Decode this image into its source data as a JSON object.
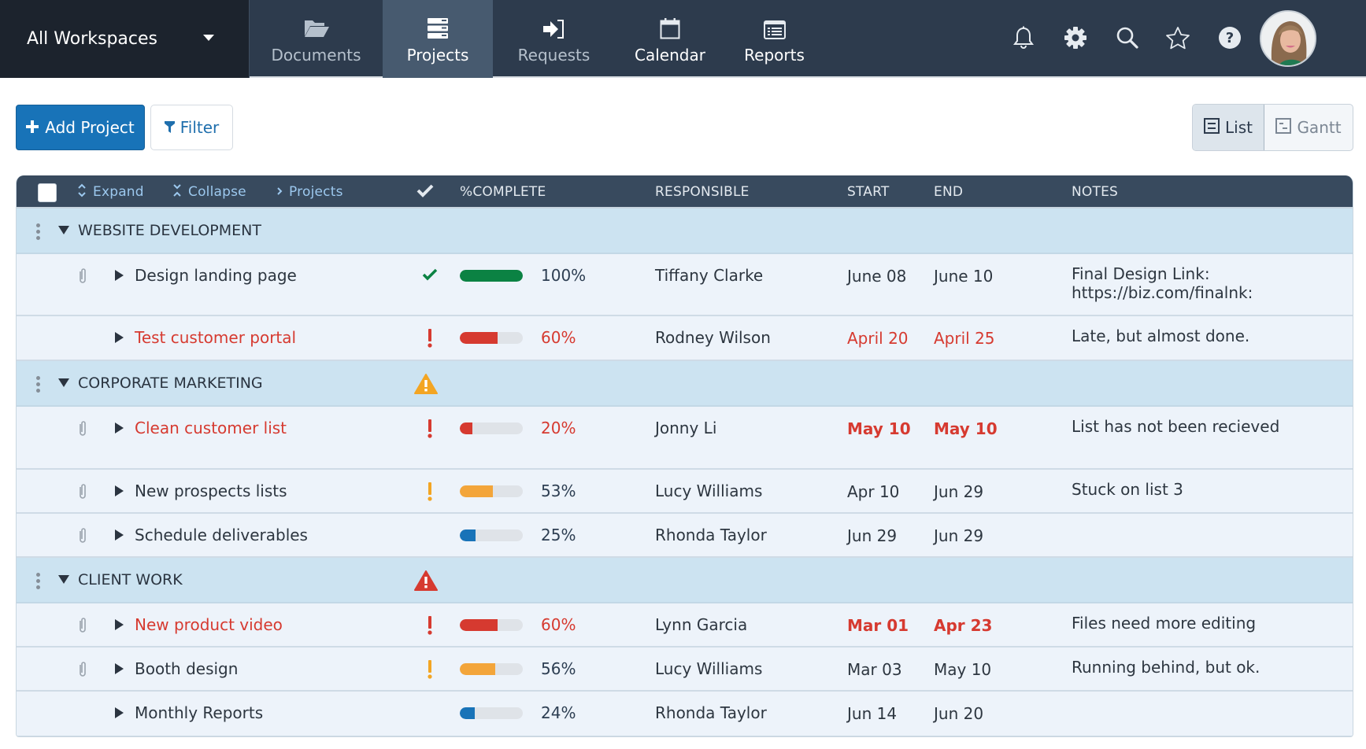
{
  "topbar": {
    "workspace": "All Workspaces",
    "tabs": [
      {
        "label": "Documents",
        "icon": "folder-open-icon",
        "active": false
      },
      {
        "label": "Projects",
        "icon": "projects-stack-icon",
        "active": true
      },
      {
        "label": "Requests",
        "icon": "sign-in-icon",
        "active": false
      },
      {
        "label": "Calendar",
        "icon": "calendar-icon",
        "active": false
      },
      {
        "label": "Reports",
        "icon": "list-alt-icon",
        "active": false
      }
    ],
    "icons": [
      "bell-icon",
      "gear-icon",
      "search-icon",
      "star-icon",
      "help-icon"
    ],
    "avatar_alt": "User avatar"
  },
  "toolbar": {
    "add_label": "Add Project",
    "filter_label": "Filter",
    "view_list": "List",
    "view_gantt": "Gantt",
    "active_view": "List"
  },
  "table": {
    "header": {
      "expand": "Expand",
      "collapse": "Collapse",
      "projects": "Projects",
      "complete": "%COMPLETE",
      "responsible": "RESPONSIBLE",
      "start": "START",
      "end": "END",
      "notes": "NOTES"
    },
    "groups": [
      {
        "title": "WEBSITE DEVELOPMENT",
        "warning": null,
        "rows": [
          {
            "name": "Design landing page",
            "late": false,
            "attachment": true,
            "status": "done",
            "percent": 100,
            "bar_color": "#0b8243",
            "responsible": "Tiffany Clarke",
            "start": "June 08",
            "end": "June 10",
            "dates_red": false,
            "dates_bold": false,
            "notes": [
              "Final Design Link:",
              "https://biz.com/finalnk:"
            ]
          },
          {
            "name": "Test customer portal",
            "late": true,
            "attachment": false,
            "status": "alert-red",
            "percent": 60,
            "bar_color": "#d63a30",
            "responsible": "Rodney Wilson",
            "start": "April 20",
            "end": "April 25",
            "dates_red": true,
            "dates_bold": false,
            "notes": [
              "Late, but almost done."
            ]
          }
        ]
      },
      {
        "title": "CORPORATE MARKETING",
        "warning": "#f3a523",
        "rows": [
          {
            "name": "Clean customer list",
            "late": true,
            "attachment": true,
            "status": "alert-red",
            "percent": 20,
            "bar_color": "#d63a30",
            "responsible": "Jonny Li",
            "start": "May 10",
            "end": "May 10",
            "dates_red": true,
            "dates_bold": true,
            "notes": [
              "List has not been recieved"
            ]
          },
          {
            "name": "New prospects lists",
            "late": false,
            "attachment": true,
            "status": "alert-orange",
            "percent": 53,
            "bar_color": "#f3a53a",
            "responsible": "Lucy Williams",
            "start": "Apr 10",
            "end": "Jun 29",
            "dates_red": false,
            "dates_bold": false,
            "notes": [
              "Stuck on list 3"
            ]
          },
          {
            "name": "Schedule deliverables",
            "late": false,
            "attachment": true,
            "status": "none",
            "percent": 25,
            "bar_color": "#1873b8",
            "responsible": "Rhonda Taylor",
            "start": "Jun 29",
            "end": "Jun 29",
            "dates_red": false,
            "dates_bold": false,
            "notes": []
          }
        ]
      },
      {
        "title": "CLIENT WORK",
        "warning": "#d63a30",
        "rows": [
          {
            "name": "New product video",
            "late": true,
            "attachment": true,
            "status": "alert-red",
            "percent": 60,
            "bar_color": "#d63a30",
            "responsible": "Lynn Garcia",
            "start": "Mar 01",
            "end": "Apr 23",
            "dates_red": true,
            "dates_bold": true,
            "notes": [
              "Files need more editing"
            ]
          },
          {
            "name": "Booth design",
            "late": false,
            "attachment": true,
            "status": "alert-orange",
            "percent": 56,
            "bar_color": "#f3a53a",
            "responsible": "Lucy Williams",
            "start": "Mar 03",
            "end": "May 10",
            "dates_red": false,
            "dates_bold": false,
            "notes": [
              "Running behind, but ok."
            ]
          },
          {
            "name": "Monthly Reports",
            "late": false,
            "attachment": false,
            "status": "none",
            "percent": 24,
            "bar_color": "#1873b8",
            "responsible": "Rhonda Taylor",
            "start": "Jun 14",
            "end": "Jun 20",
            "dates_red": false,
            "dates_bold": false,
            "notes": []
          }
        ]
      }
    ]
  }
}
